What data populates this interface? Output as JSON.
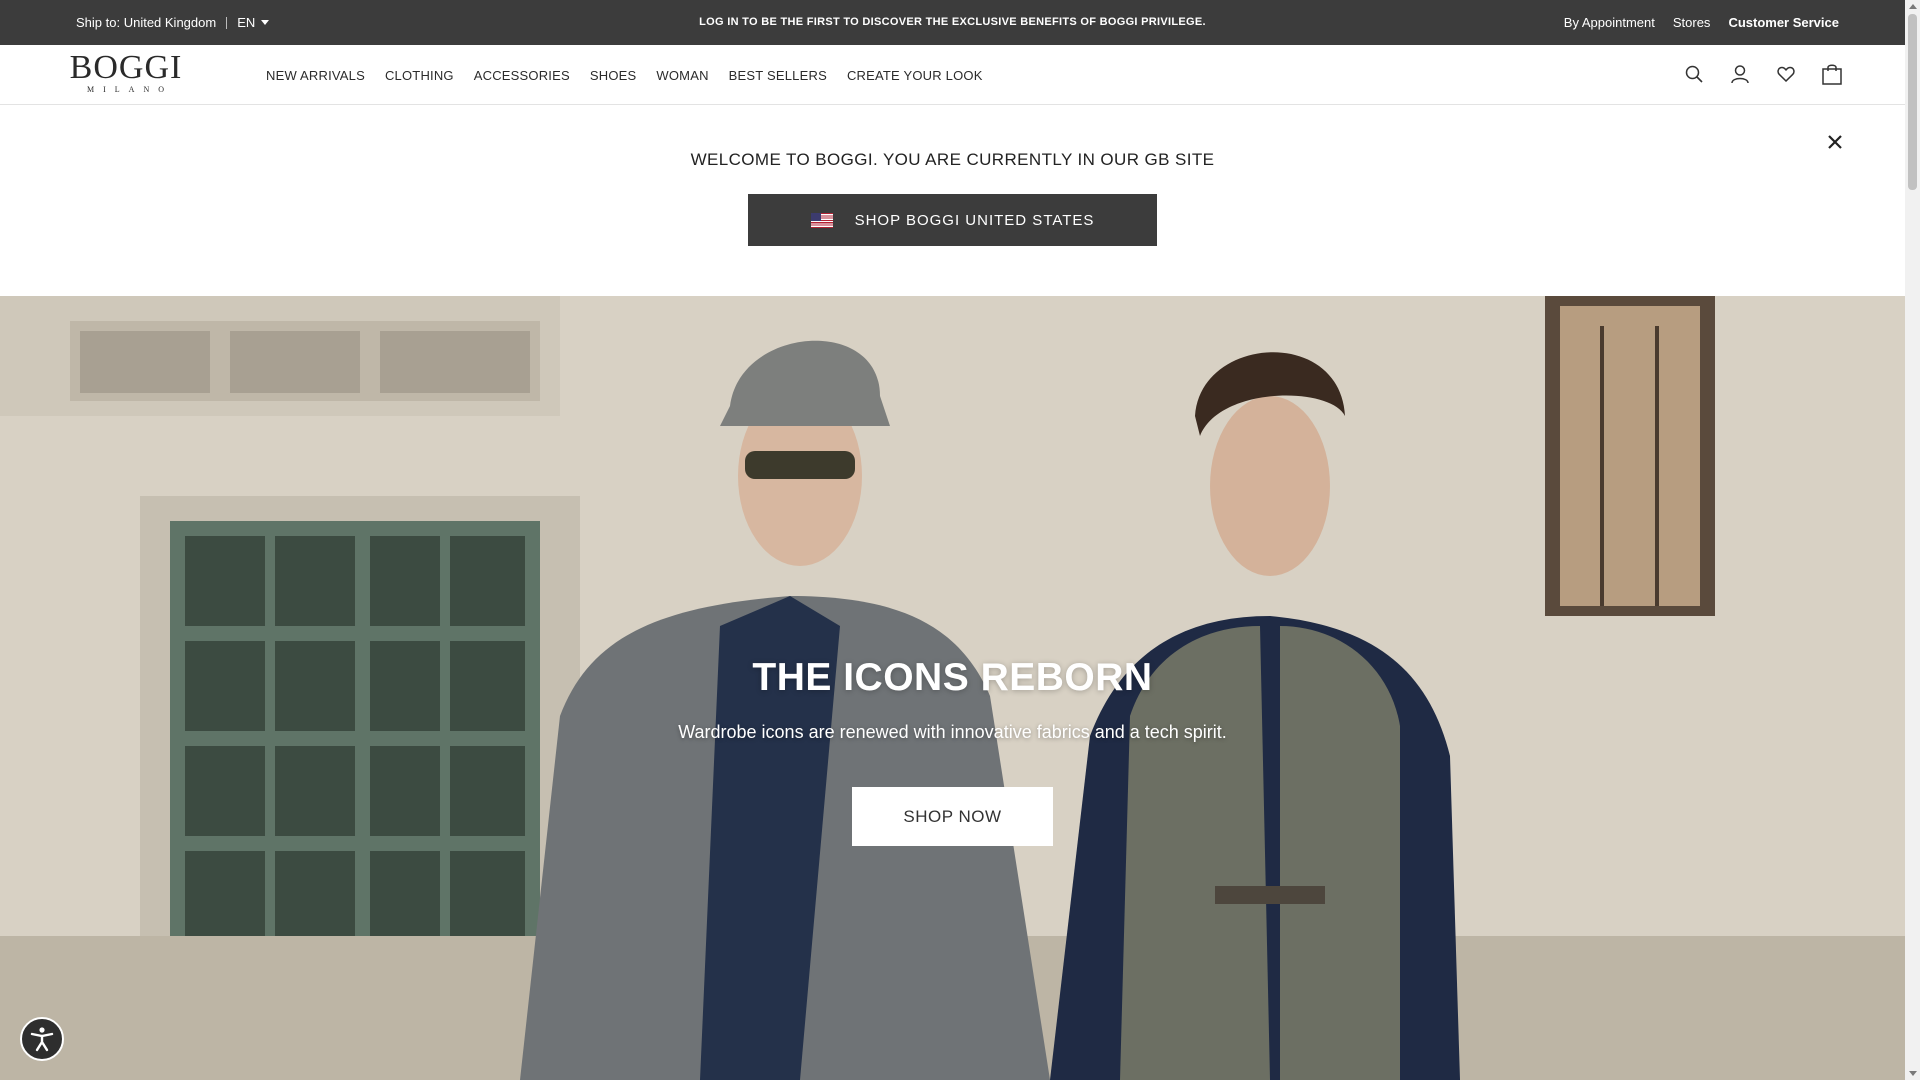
{
  "topbar": {
    "ship_to": "Ship to: United Kingdom",
    "language": "EN",
    "promo": "LOG IN TO BE THE FIRST TO DISCOVER THE EXCLUSIVE BENEFITS OF BOGGI PRIVILEGE.",
    "links": {
      "appointment": "By Appointment",
      "stores": "Stores",
      "customer_service": "Customer Service"
    }
  },
  "header": {
    "logo_word": "BOGGI",
    "logo_sub": "MILANO",
    "nav": [
      "NEW ARRIVALS",
      "CLOTHING",
      "ACCESSORIES",
      "SHOES",
      "WOMAN",
      "BEST SELLERS",
      "CREATE YOUR LOOK"
    ],
    "icons": [
      "search-icon",
      "account-icon",
      "wishlist-heart-icon",
      "shopping-bag-icon"
    ]
  },
  "welcome": {
    "message": "WELCOME TO BOGGI. YOU ARE CURRENTLY IN OUR GB SITE",
    "cta": "SHOP BOGGI UNITED STATES"
  },
  "hero": {
    "title": "THE ICONS REBORN",
    "description": "Wardrobe icons are renewed with innovative fabrics and a tech spirit.",
    "cta": "SHOP NOW"
  },
  "colors": {
    "topbar_bg": "#3c3c3c",
    "cta_bg": "#3c3c3c",
    "text": "#222222"
  }
}
